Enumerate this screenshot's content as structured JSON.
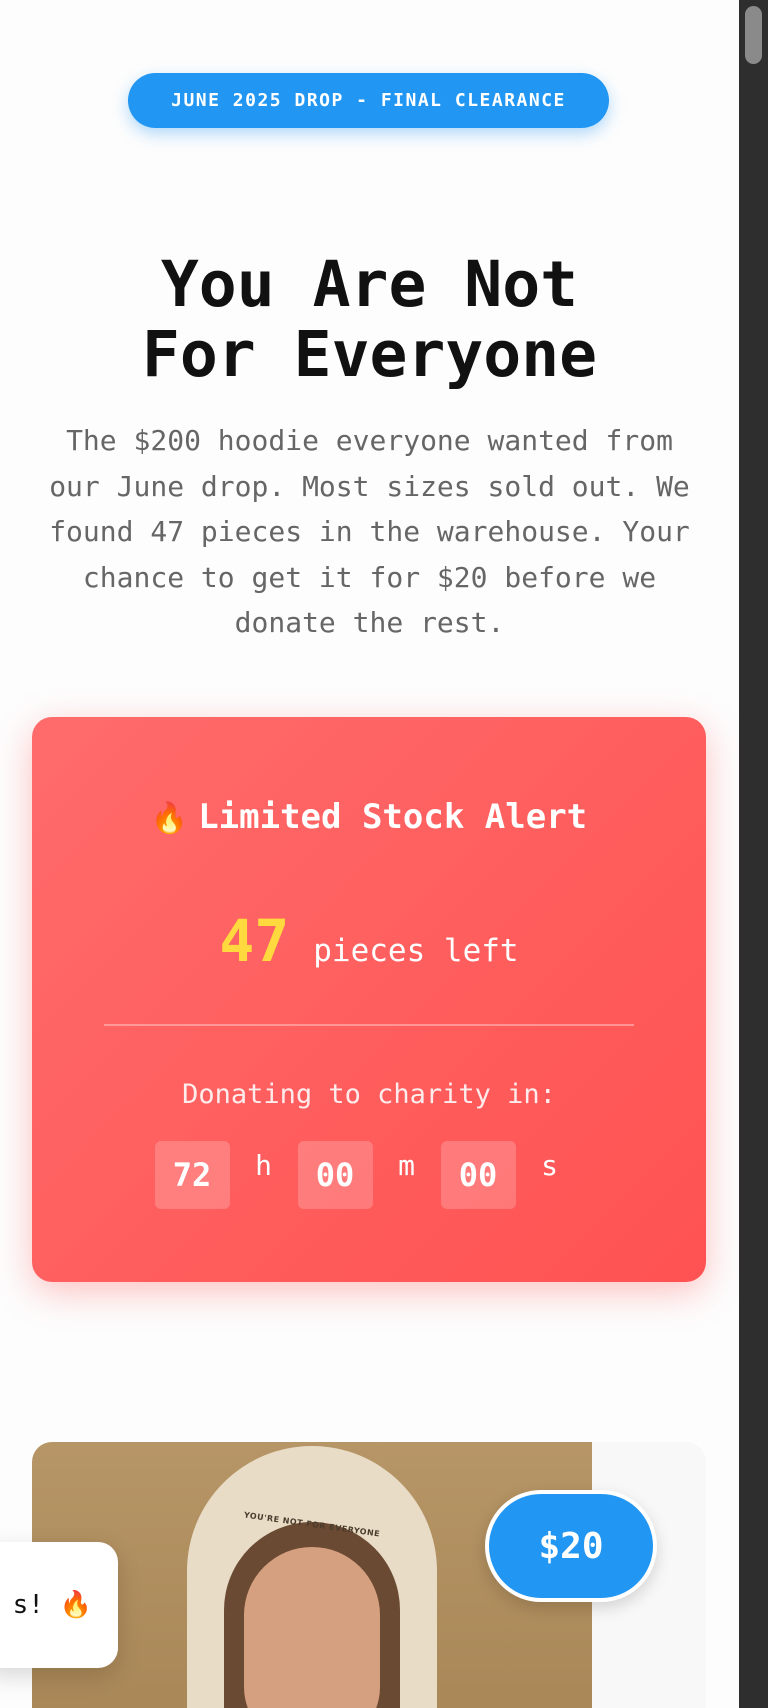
{
  "badge": {
    "label": "JUNE 2025 DROP - FINAL CLEARANCE"
  },
  "hero": {
    "title_line1": "You Are Not",
    "title_line2": "For Everyone",
    "subtext": "The $200 hoodie everyone wanted from our June drop. Most sizes sold out. We found 47 pieces in the warehouse. Your chance to get it for $20 before we donate the rest."
  },
  "alert": {
    "icon": "fire-icon",
    "icon_glyph": "🔥",
    "title": "Limited Stock Alert",
    "stock_count": "47",
    "stock_label": "pieces left",
    "donate_label": "Donating to charity in:",
    "timer": {
      "hours": "72",
      "hours_unit": "h",
      "minutes": "00",
      "minutes_unit": "m",
      "seconds": "00",
      "seconds_unit": "s"
    }
  },
  "product": {
    "price": "$20",
    "hood_print": "YOU'RE NOT FOR EVERYONE"
  },
  "toast": {
    "text": "s! ",
    "icon_glyph": "🔥"
  },
  "colors": {
    "accent": "#2196f3",
    "alert_start": "#ff6b6b",
    "alert_end": "#ff5252",
    "stock_highlight": "#ffd93d"
  }
}
